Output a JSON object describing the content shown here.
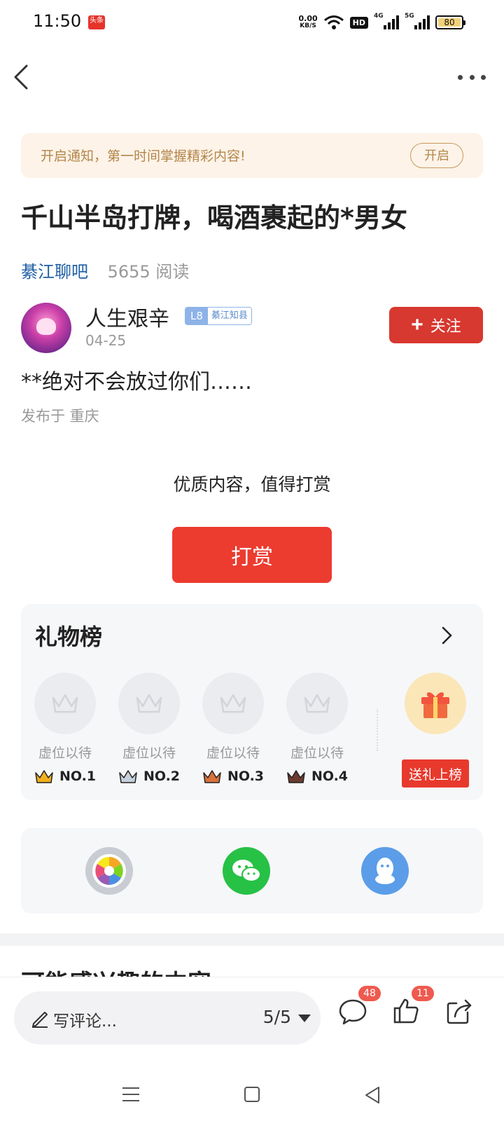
{
  "status_bar": {
    "time": "11:50",
    "app_badge": "头条",
    "net_speed_value": "0.00",
    "net_speed_unit": "KB/S",
    "hd": "HD",
    "network_1": "4G",
    "network_2": "5G",
    "battery": "80"
  },
  "notice": {
    "text": "开启通知，第一时间掌握精彩内容!",
    "button": "开启"
  },
  "post": {
    "title": "千山半岛打牌，喝酒裹起的*男女",
    "forum": "綦江聊吧",
    "reads": "5655 阅读",
    "author": "人生艰辛",
    "level": "L8",
    "level_name": "綦江知县",
    "date": "04-25",
    "follow_label": "关注",
    "content": "**绝对不会放过你们……",
    "location": "发布于 重庆"
  },
  "reward": {
    "prompt": "优质内容，值得打赏",
    "button": "打赏"
  },
  "gift_board": {
    "title": "礼物榜",
    "slots": [
      {
        "label": "虚位以待",
        "rank": "NO.1",
        "crown_color": "#f2b01e"
      },
      {
        "label": "虚位以待",
        "rank": "NO.2",
        "crown_color": "#9aa6b8"
      },
      {
        "label": "虚位以待",
        "rank": "NO.3",
        "crown_color": "#d9733a"
      },
      {
        "label": "虚位以待",
        "rank": "NO.4",
        "crown_color": "#6b3b2e"
      }
    ],
    "send_button": "送礼上榜"
  },
  "share": {
    "items": [
      "moments-icon",
      "wechat-icon",
      "qq-icon"
    ]
  },
  "recommend": {
    "title": "可能感兴趣的内容"
  },
  "bottom_bar": {
    "comment_placeholder": "写评论...",
    "page": "5/5",
    "comment_count": "48",
    "like_count": "11"
  },
  "colors": {
    "accent_red": "#d7382f",
    "reward_red": "#ec3b2f",
    "forum_blue": "#1f5fa5",
    "notice_bg": "#fdf3e8"
  }
}
